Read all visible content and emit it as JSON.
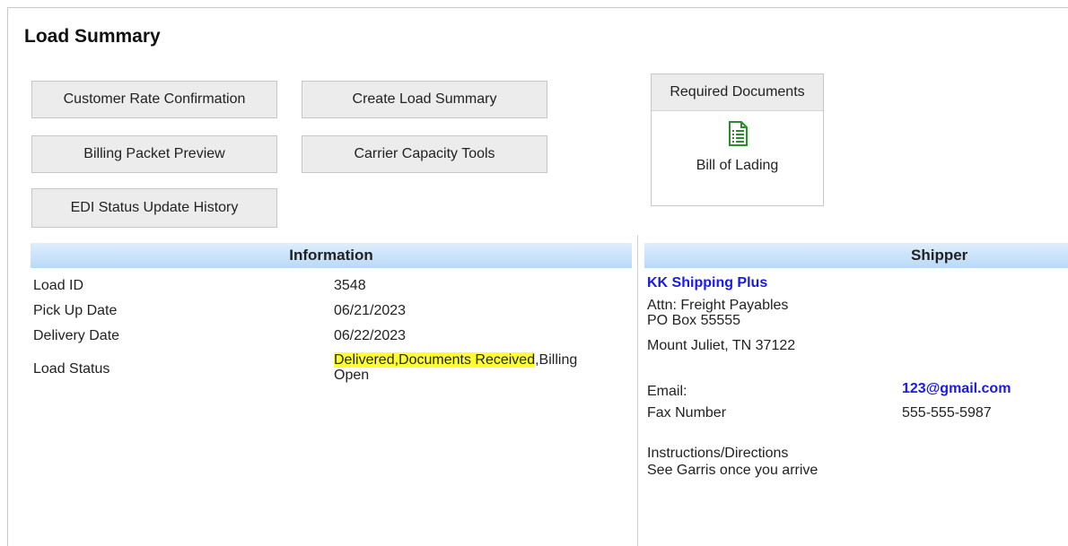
{
  "page": {
    "title": "Load Summary"
  },
  "actions": {
    "customer_rate_confirmation": "Customer Rate Confirmation",
    "create_load_summary": "Create Load Summary",
    "billing_packet_preview": "Billing Packet Preview",
    "carrier_capacity_tools": "Carrier Capacity Tools",
    "edi_status_update_history": "EDI Status Update History"
  },
  "required_documents": {
    "header": "Required Documents",
    "items": [
      {
        "label": "Bill of Lading",
        "icon": "document-icon",
        "icon_color": "#2e8b2e"
      }
    ]
  },
  "information": {
    "header": "Information",
    "rows": [
      {
        "label": "Load ID",
        "value": "3548"
      },
      {
        "label": "Pick Up Date",
        "value": "06/21/2023"
      },
      {
        "label": "Delivery Date",
        "value": "06/22/2023"
      },
      {
        "label": "Load Status"
      }
    ],
    "load_status": {
      "part1": "Delivered,",
      "part2": "Documents Received",
      "part3": ",Billing",
      "part4": "Open"
    }
  },
  "shipper": {
    "header": "Shipper",
    "name": "KK Shipping Plus",
    "attn": "Attn: Freight Payables",
    "address1": "PO Box 55555",
    "address2": "Mount Juliet, TN 37122",
    "email_label": "Email:",
    "email": "123@gmail.com",
    "fax_label": "Fax Number",
    "fax": "555-555-5987",
    "instructions_label": "Instructions/Directions",
    "instructions": "See Garris once you arrive"
  },
  "colors": {
    "header_gradient_top": "#dfeefc",
    "header_gradient_bottom": "#b9d9f7",
    "highlight": "#ffff33",
    "link": "#1a1ae6"
  }
}
